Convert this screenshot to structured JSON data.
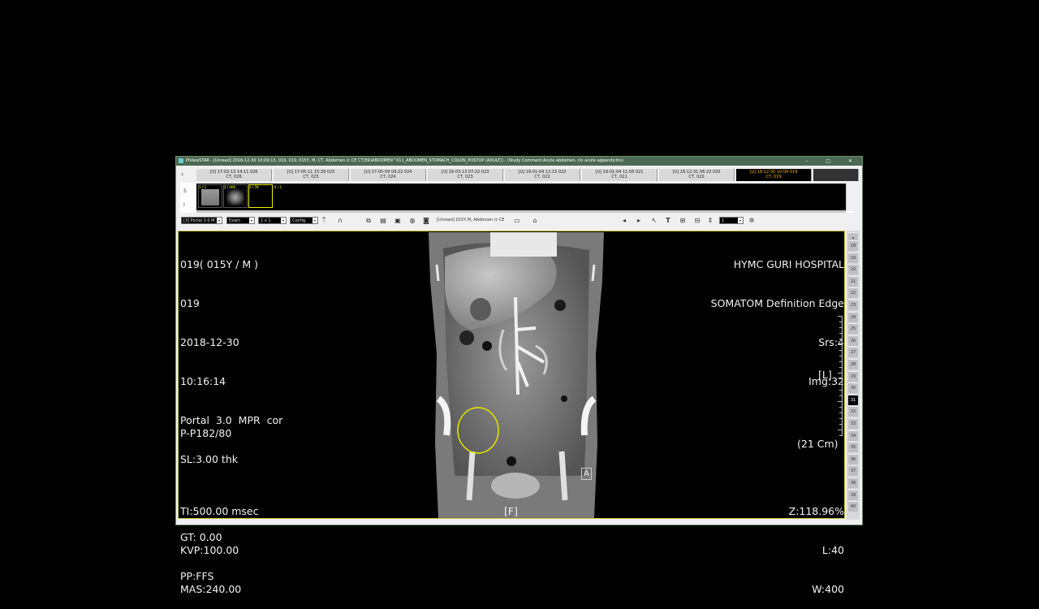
{
  "window": {
    "title": "PiViewSTAR - [Unread] 2018-12-30 10:09:13, 019, 019, 015Y, M, CT, Abdomen /c CE CT(ER)ABDOMEN^011_ABDOMEN_STOMACH_COLON_POSTOP (ADULT)) - (Study Comment:Acute abdomen, r/o acute appendicitis)",
    "controls": "– □ ✕"
  },
  "tabs": [
    {
      "line1": "[U] 17-02-13 14:11  026",
      "line2": "CT, 026"
    },
    {
      "line1": "[U] 17-05-11 15:39  025",
      "line2": "CT, 025"
    },
    {
      "line1": "[U] 17-05-09 09:22  024",
      "line2": "CT, 024"
    },
    {
      "line1": "[U] 16-03-13 07:22  023",
      "line2": "CT, 023"
    },
    {
      "line1": "[U] 19-01-04 12:15  022",
      "line2": "CT, 022"
    },
    {
      "line1": "[U] 19-01-04 11:56  021",
      "line2": "CT, 021"
    },
    {
      "line1": "[U] 18-12-31 06:22  020",
      "line2": "CT, 020"
    },
    {
      "line1": "[U] 18-12-30 10:09  019",
      "line2": "CT, 019"
    }
  ],
  "strip": {
    "labels": [
      "S",
      "I"
    ],
    "thumbs": [
      "1 / 2",
      "2 / 466",
      "3 / 78",
      "4 / 1"
    ]
  },
  "toolbar": {
    "series_combo": "[3] Portal  3.0  M",
    "exam_combo": "Exam",
    "layout_combo": "1 x 1",
    "config_combo": "Config.",
    "study_label": "[Unread] 015Y,M, Abdomen /c CE",
    "page_combo": "1"
  },
  "overlay": {
    "top_left": [
      "019( 015Y / M )",
      "019",
      "2018-12-30",
      "10:16:14",
      "Portal  3.0  MPR  cor",
      "SL:3.00 thk",
      "",
      "GT: 0.00",
      "PP:FFS"
    ],
    "top_right": [
      "HYMC GURI HOSPITAL",
      "SOMATOM Definition Edge",
      "Srs:4",
      "Img:32"
    ],
    "mid_left": "P-P182/80",
    "orient_right": "[L]",
    "scale_label": "(21 Cm)",
    "orient_bottom": "[F]",
    "bottom_left": [
      "TI:500.00 msec",
      "KVP:100.00",
      "MAS:240.00"
    ],
    "bottom_right": [
      "Z:118.96%",
      "L:40",
      "W:400"
    ],
    "marker": "A"
  },
  "side_numbers": [
    "18",
    "19",
    "20",
    "21",
    "22",
    "23",
    "24",
    "25",
    "26",
    "27",
    "28",
    "29",
    "30",
    "31",
    "32",
    "33",
    "34",
    "35",
    "36",
    "37",
    "38",
    "39",
    "40"
  ],
  "current_image": "31",
  "colors": {
    "titlebar": "#4c6a53",
    "active_tab_text": "#ffb000",
    "viewer_border": "#c8c040",
    "roi": "#e6e600"
  }
}
